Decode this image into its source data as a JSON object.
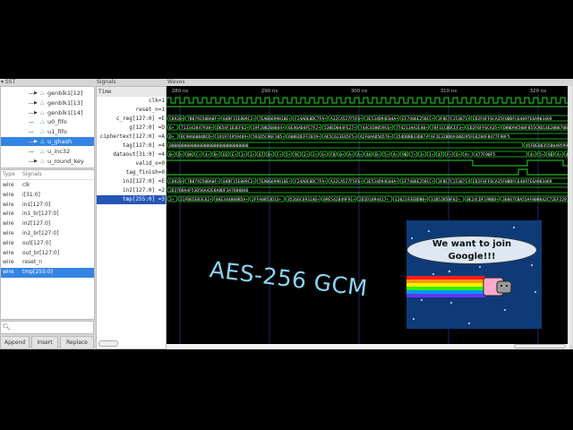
{
  "headers": {
    "sst": "▾ SST",
    "signals": "Signals",
    "waves": "Waves"
  },
  "tree": [
    {
      "label": "genblk1[12]",
      "expandable": true
    },
    {
      "label": "genblk1[13]",
      "expandable": true
    },
    {
      "label": "genblk1[14]",
      "expandable": true
    },
    {
      "label": "u0_fifo",
      "expandable": false
    },
    {
      "label": "u1_fifo",
      "expandable": false
    },
    {
      "label": "u_ghash",
      "expandable": true,
      "selected": true
    },
    {
      "label": "u_inc32",
      "expandable": false
    },
    {
      "label": "u_round_key",
      "expandable": true
    }
  ],
  "signal_list": {
    "col_type": "Type",
    "col_signals": "Signals",
    "rows": [
      {
        "type": "wire",
        "name": "clk"
      },
      {
        "type": "wire",
        "name": "i[31:0]"
      },
      {
        "type": "wire",
        "name": "in1[127:0]"
      },
      {
        "type": "wire",
        "name": "in1_br[127:0]"
      },
      {
        "type": "wire",
        "name": "in2[127:0]"
      },
      {
        "type": "wire",
        "name": "in2_br[127:0]"
      },
      {
        "type": "wire",
        "name": "out[127:0]"
      },
      {
        "type": "wire",
        "name": "out_br[127:0]"
      },
      {
        "type": "wire",
        "name": "reset_n"
      },
      {
        "type": "wire",
        "name": "tmp[255:0]",
        "selected": true
      }
    ]
  },
  "search": {
    "icon": "search-icon",
    "value": ""
  },
  "buttons": {
    "append": "Append",
    "insert": "Insert",
    "replace": "Replace"
  },
  "time_label": "Time",
  "timeline": {
    "labels": [
      "280 ns",
      "290 ns",
      "300 ns",
      "310 ns",
      "320 ns"
    ],
    "ticks_ns": [
      280,
      290,
      300,
      310,
      320
    ],
    "start_ns": 278.5,
    "end_ns": 323.3
  },
  "traces": [
    {
      "label": "clk=1",
      "kind": "clock",
      "period_ns": 1
    },
    {
      "label": "reset_n=1",
      "kind": "bit",
      "edges": [
        [
          278.5,
          1
        ]
      ]
    },
    {
      "label": "c_reg[127:0] =E",
      "kind": "bus",
      "values": [
        "C8928+",
        "7B879250BA0F+",
        "04BF15E809C2+",
        "7EAB6699810E+",
        "F24ADE0DC7FA+",
        "A32CA527F5F6+",
        "3E534D94E04A+",
        "EF7406E258CC+",
        "3F8E7C153071+",
        "ED2F6FF6CA35F0BDFC64697E6A903469"
      ],
      "starts": [
        278.5,
        280.5,
        284.5,
        288.5,
        292.5,
        296.5,
        300.5,
        304.5,
        308.5,
        312.4
      ]
    },
    {
      "label": "g[127:0] =D",
      "kind": "bus",
      "values": [
        "6+",
        "713343847938+",
        "D654F1D3EF62+",
        "19F20B268844+",
        "6E46AD4FE7F2+",
        "530ED044FE27+",
        "744C830059C6+",
        "774213AA2E40+",
        "78F1EC0DCEF3+",
        "ED2F6FF6CA35+",
        "D80D94508F055CAD1462B0070B"
      ],
      "starts": [
        278.5,
        279.8,
        283.8,
        287.8,
        291.8,
        295.8,
        299.8,
        303.8,
        307.8,
        311.8,
        315.8
      ]
    },
    {
      "label": "ciphertext[127:0] =A",
      "kind": "bus",
      "values": [
        "D+",
        "BC9066004BCD+",
        "191974959489+",
        "591D5C96F305+",
        "608EDEFF2019+",
        "AE5C623E65F5+",
        "A2F0AAD56576+",
        "154DB8B33D07+",
        "AF2E320D6930B295FE8284F8477F90F5"
      ],
      "starts": [
        278.5,
        279.8,
        283.8,
        287.8,
        291.8,
        295.8,
        299.8,
        303.8,
        307.7
      ]
    },
    {
      "label": "tag[127:0] =4",
      "kind": "bus",
      "values": [
        "00000000000000000000000000000000",
        "45FBE0835580495990C"
      ],
      "starts": [
        278.5,
        318.3
      ]
    },
    {
      "label": "dataout[31:0] =4",
      "kind": "bus",
      "values": [
        "0+",
        "D+",
        "0A+",
        "C+",
        "4+",
        "B+",
        "D2+",
        "E+",
        "3+",
        "1+",
        "67+",
        "B+",
        "F+",
        "5+",
        "9C+",
        "2+",
        "2+",
        "6+",
        "F8+",
        "0+",
        "A+",
        "A+",
        "4A+",
        "B+",
        "5+",
        "A+",
        "9B+",
        "7+",
        "3+",
        "1+",
        "47+",
        "F+",
        "6+",
        "A+",
        "477F90F5",
        "4+",
        "5+",
        "9D+",
        "A+",
        "4"
      ],
      "starts": [
        278.5,
        279.5,
        280.5,
        281.5,
        282.5,
        283.5,
        284.5,
        285.5,
        286.5,
        287.5,
        288.5,
        289.5,
        290.5,
        291.5,
        292.5,
        293.5,
        294.5,
        295.5,
        296.5,
        297.5,
        298.5,
        299.5,
        300.5,
        301.5,
        302.5,
        303.5,
        304.5,
        305.5,
        306.5,
        307.5,
        308.5,
        309.5,
        310.5,
        311.5,
        312.7,
        318.8,
        319.8,
        320.8,
        321.8,
        322.8
      ]
    },
    {
      "label": "valid_o=0",
      "kind": "bit",
      "edges": [
        [
          278.5,
          1
        ],
        [
          312.7,
          0
        ],
        [
          318.8,
          1
        ],
        [
          322.8,
          0
        ]
      ]
    },
    {
      "label": "tag_finish=0",
      "kind": "bit",
      "edges": [
        [
          278.5,
          0
        ],
        [
          317.8,
          1
        ],
        [
          318.8,
          0
        ]
      ]
    },
    {
      "label": "in1[127:0] =E",
      "kind": "bus",
      "values": [
        "C8928+",
        "7B879250BA0F+",
        "04BF15E809C2+",
        "7EAB6699810E+",
        "F24ADE0DC7FA+",
        "A32CA527F5F6+",
        "3E534D94E04A+",
        "EF7406E258CC+",
        "3F8E7C153071+",
        "ED2F6FF6CA35F0BDFC64697E6A903469"
      ],
      "starts": [
        278.5,
        280.5,
        284.5,
        288.5,
        292.5,
        296.5,
        300.5,
        304.5,
        308.5,
        312.4
      ]
    },
    {
      "label": "in2[127:0] =2",
      "kind": "bus",
      "values": [
        "2D37D8A4F53D56A42E8A8DF3A7686B46"
      ],
      "starts": [
        278.5
      ]
    },
    {
      "label": "tmp[255:0] =3",
      "kind": "bus",
      "selected": true,
      "values": [
        "2+",
        "31FB65EB3C62+",
        "04E344068B5A+",
        "2FFA0853D13+",
        "35266C693246+",
        "09E542849F91+",
        "2D1D1094417+",
        "1202193EBDB0+",
        "31B52B5BF82+",
        "0E24CDF19B6D+",
        "36067CBA55AF008042C72EF229"
      ],
      "starts": [
        278.5,
        279.7,
        283.7,
        287.7,
        291.7,
        295.7,
        299.7,
        303.7,
        307.7,
        311.7,
        315.7
      ]
    }
  ],
  "overlay": {
    "title": "AES-256 GCM",
    "bubble_line1": "We want to join",
    "bubble_line2": "Google!!!"
  },
  "colors": {
    "trace": "#1fdc1f",
    "bus_text": "#ffffff",
    "grid": "#232366",
    "selection": "#3584e4",
    "title": "#8ad6f2"
  }
}
